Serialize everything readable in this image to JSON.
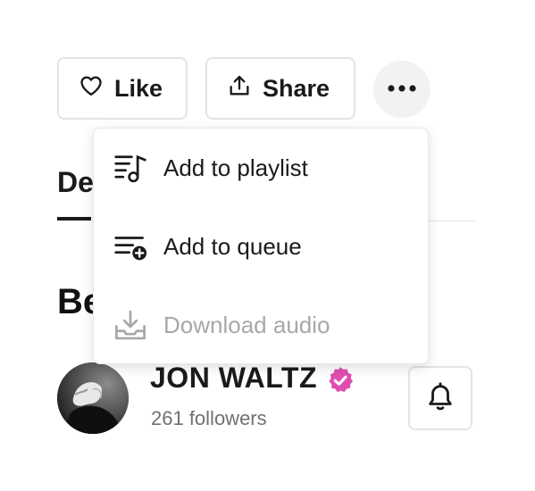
{
  "actions": {
    "like_label": "Like",
    "share_label": "Share",
    "more_icon": "more-horizontal-icon"
  },
  "background": {
    "tab_partial": "De",
    "heading_partial": "Be"
  },
  "menu": {
    "items": [
      {
        "label": "Add to playlist",
        "icon": "playlist-add-icon",
        "disabled": false
      },
      {
        "label": "Add to queue",
        "icon": "queue-add-icon",
        "disabled": false
      },
      {
        "label": "Download audio",
        "icon": "download-icon",
        "disabled": true
      }
    ]
  },
  "artist": {
    "name": "JON WALTZ",
    "followers": "261 followers",
    "verified": true,
    "verified_color": "#e04fb0"
  },
  "colors": {
    "text": "#1a1a1a",
    "muted": "#707070",
    "disabled": "#a8a8a8",
    "border": "#e4e4e4"
  }
}
